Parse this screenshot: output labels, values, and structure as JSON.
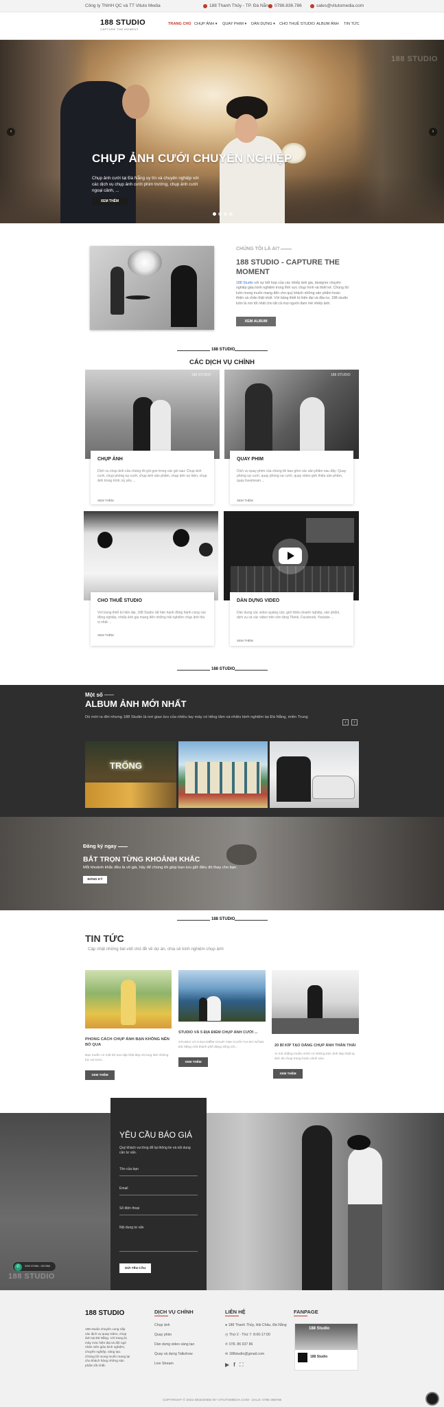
{
  "topbar": {
    "company": "Công ty TNHH QC và TT Vituto Media",
    "address": "188 Thanh Thủy - TP. Đà Nẵng",
    "phone": "0786.836.786",
    "email": "sales@vitutomedia.com"
  },
  "header": {
    "logo": "188 STUDIO",
    "logo_sub": "CAPTURE THE MOMENT",
    "nav": [
      "TRANG CHỦ",
      "CHỤP ẢNH",
      "QUAY PHIM",
      "DÀN DỰNG",
      "CHO THUÊ STUDIO",
      "ALBUM ẢNH",
      "TIN TỨC"
    ],
    "nav_active_color": "#c0392b"
  },
  "hero": {
    "title": "CHỤP ẢNH CƯỚI CHUYÊN NGHIỆP",
    "desc": "Chụp ảnh cưới tại Đà Nẵng uy tín và chuyên nghiệp với các dịch vụ chụp ảnh cưới phim trường, chụp ảnh cưới ngoại cảnh, ...",
    "button": "XEM THÊM",
    "watermark": "188 STUDIO",
    "prev": "‹",
    "next": "›",
    "slide_count": 4,
    "active_slide": 1
  },
  "about": {
    "kicker": "CHÚNG TÔI LÀ AI?",
    "title_line1": "188 STUDIO - CAPTURE THE",
    "title_line2": "MOMENT",
    "text_highlight": "188 Studio",
    "text": " với sự kết hợp của các nhiếp ảnh gia, designer chuyên nghiệp giàu kinh nghiệm trong lĩnh vực chụp hình và thiết kế. Chúng tôi luôn mong muốn mang đến cho quý khách những sản phẩm hoàn thiện và chân thật nhất. Với bảng thiết bị hiện đại và đầu tư, 188 studio luôn là nơi tốt nhất cho tất cả mọi người đam mê nhiếp ảnh.",
    "button": "XEM ALBUM"
  },
  "services": {
    "mini_logo": "188 STUDIO",
    "title": "CÁC DỊCH VỤ CHÍNH",
    "items": [
      {
        "title": "CHỤP ẢNH",
        "desc": "Dịch vụ chụp ảnh của chúng tôi gói gọn trong các gói sau: Chụp ảnh cưới, chụp phóng sự cưới, chụp ảnh sản phẩm, chụp ảnh sự kiện, chụp ảnh trong trình, kỷ yếu ...",
        "more": "XEM THÊM"
      },
      {
        "title": "QUAY PHIM",
        "desc": "Dịch vụ quay phim của chúng tôi bao gồm các sản phẩm sau đây: Quay phóng sự cưới, quay phóng sự cưới, quay video giới thiệu sản phẩm, quay livestream ...",
        "more": "XEM THÊM"
      },
      {
        "title": "CHO THUÊ STUDIO",
        "desc": "Với trang thiết bị hiện đại, 188 Studio rất hân hạnh đồng hành cùng các đồng nghiệp, nhiếp ảnh gia mang đến những trải nghiệm chụp ảnh thú vị nhất ...",
        "more": "XEM THÊM"
      },
      {
        "title": "DÀN DỰNG VIDEO",
        "desc": "Dàn dựng các video quảng cáo, giới thiệu doanh nghiệp, sản phẩm, dịch vụ và các video trên nền tảng Tiktok, Facebook, Youtube ...",
        "more": "XEM THÊM"
      }
    ],
    "watermark": "188 STUDIO"
  },
  "album": {
    "kicker": "Một số",
    "title": "ALBUM ẢNH MỚI NHẤT",
    "desc": "Dù mới ra đời nhưng 188 Studio là nơi giao lưu của nhiều tay máy có tiếng tăm và nhiều kinh nghiệm tại Đà Nẵng, miền Trung",
    "photo1_sign": "TRỐNG",
    "prev": "‹",
    "next": "›"
  },
  "subscribe": {
    "kicker": "Đăng ký ngay",
    "title": "BẮT TRỌN TỪNG KHOẢNH KHẮC",
    "desc": "Mỗi khoảnh khắc đều là vô giá, hãy để chúng tôi giúp bạn lưu giữ điều đó thay cho bạn.",
    "button": "ĐĂNG KÝ"
  },
  "news": {
    "mini_logo": "188 STUDIO",
    "title": "TIN TỨC",
    "desc": "Cập nhật những bài viết chủ đề về dự án, chia sẻ kinh nghiệm chụp ảnh",
    "items": [
      {
        "title": "PHONG CÁCH CHỤP ẢNH BẠN KHÔNG NÊN BỎ QUA",
        "desc": "Bạn muốn có một bộ sưu tập thật đẹp và lung linh những lúc vui tươi...",
        "button": "XEM THÊM"
      },
      {
        "title": "STUDIO VÀ 5 ĐỊA ĐIỂM CHỤP ẢNH CƯỚI ...",
        "desc": "STUDIO VÀ 5 ĐỊA ĐIỂM CHỤP ẢNH CƯỚI TẠI ĐÀ NẴNG Đà Nẵng một thành phố đáng sống với...",
        "button": "XEM THÊM"
      },
      {
        "title": "20 BÍ KÍP TẠO DÁNG CHỤP ẢNH THẦN THÁI",
        "desc": "Ai mà chẳng muốn mình có những bức ảnh đẹp thật lạ, ảnh dù chụp trong hoàn cảnh nào.",
        "button": "XEM THÊM"
      }
    ]
  },
  "quote_form": {
    "title": "YÊU CẦU BÁO GIÁ",
    "desc": "Quý khách vui lòng để lại thông tin và nội dung cần tư vấn.",
    "fields": [
      "Tên của bạn",
      "Email",
      "Số điện thoại",
      "Nội dung tư vấn"
    ],
    "button": "GỬI YÊU CẦU",
    "watermark": "188 STUDIO"
  },
  "footer": {
    "logo": "188 STUDIO",
    "about": "188 studio chuyên cung cấp các dịch vụ quay video, chụp ảnh tại Đà Nẵng. Với trang bị máy móc hiện đại và đội ngũ nhân viên giàu kinh nghiệm, chuyên nghiệp, sáng tạo. Chúng tôi mong muốn mang lại cho khách hàng những sản phẩm tốt nhất.",
    "services_title": "DỊCH VỤ CHÍNH",
    "services": [
      "Chụp ảnh",
      "Quay phim",
      "Dàn dựng video sáng tạo",
      "Quay và dựng Talkshow",
      "Live Stream"
    ],
    "contact_title": "LIÊN HỆ",
    "contact": [
      "188 Thanh Thủy, Hải Châu, Đà Nẵng",
      "Thứ 2 - Thứ 7: 8:00-17:00",
      "078. 86 937 86",
      "188studio@gmail.com"
    ],
    "fanpage_title": "FANPAGE",
    "fanpage_name": "188 Studio",
    "copyright": "COPYRIGHT © 2022 DESIGNED BY VITUTOMEDIA.COM - ZALO: 0786 398786",
    "zalo_label": "0935 070966 - 0817866",
    "colors": {
      "dark": "#2e2e2e",
      "accent": "#c0392b"
    }
  }
}
